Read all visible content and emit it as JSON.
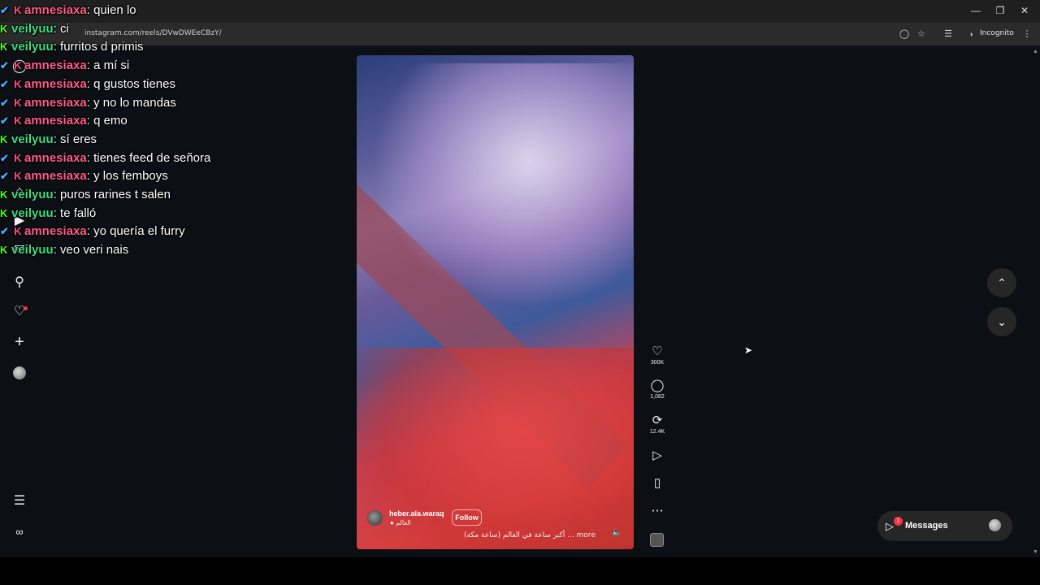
{
  "browser": {
    "url": "instagram.com/reels/DVwDWEeCBzY/",
    "incognito_label": "Incognito"
  },
  "reel": {
    "username": "heber.ala.waraq",
    "location": "العالم",
    "follow_label": "Follow",
    "caption": "أكبر ساعة في العالم (ساعة مكة) ... more",
    "likes": "300K",
    "comments": "1,082",
    "reposts": "12.4K"
  },
  "messages": {
    "label": "Messages",
    "badge": "1"
  },
  "chat": [
    {
      "user": "amnesiaxa",
      "text": ": quien lo",
      "color": "pink",
      "badges": [
        "v",
        "k2"
      ]
    },
    {
      "user": "veilyuu",
      "text": ": ci",
      "color": "green",
      "badges": [
        "k"
      ]
    },
    {
      "user": "veilyuu",
      "text": ": furritos d primis",
      "color": "green",
      "badges": [
        "k"
      ]
    },
    {
      "user": "amnesiaxa",
      "text": ": a mí si",
      "color": "pink",
      "badges": [
        "v",
        "k2"
      ]
    },
    {
      "user": "amnesiaxa",
      "text": ": q gustos tienes",
      "color": "pink",
      "badges": [
        "v",
        "k2"
      ]
    },
    {
      "user": "amnesiaxa",
      "text": ": y no lo mandas",
      "color": "pink",
      "badges": [
        "v",
        "k2"
      ]
    },
    {
      "user": "amnesiaxa",
      "text": ": q emo",
      "color": "pink",
      "badges": [
        "v",
        "k2"
      ]
    },
    {
      "user": "veilyuu",
      "text": ": sí eres",
      "color": "green",
      "badges": [
        "k"
      ]
    },
    {
      "user": "amnesiaxa",
      "text": ": tienes feed de señora",
      "color": "pink",
      "badges": [
        "v",
        "k2"
      ]
    },
    {
      "user": "amnesiaxa",
      "text": ": y los femboys",
      "color": "pink",
      "badges": [
        "v",
        "k2"
      ]
    },
    {
      "user": "veilyuu",
      "text": ": puros rarines t salen",
      "color": "green",
      "badges": [
        "k"
      ]
    },
    {
      "user": "veilyuu",
      "text": ": te falló",
      "color": "green",
      "badges": [
        "k"
      ]
    },
    {
      "user": "amnesiaxa",
      "text": ": yo quería el furry",
      "color": "pink",
      "badges": [
        "v",
        "k2"
      ]
    },
    {
      "user": "veilyuu",
      "text": ": veo veri nais",
      "color": "green",
      "badges": [
        "k"
      ]
    }
  ],
  "colors": {
    "background": "#0c1014",
    "chat_pink": "#ff5c8a",
    "chat_green": "#3ddc84",
    "badge_blue": "#4aa8ff",
    "badge_kick": "#53fc18",
    "notification_red": "#ff3040"
  },
  "icons": {
    "nav": [
      "home-icon",
      "reels-icon",
      "messenger-icon",
      "search-icon",
      "heart-icon",
      "create-icon",
      "profile-icon",
      "more-menu-icon",
      "meta-icon"
    ],
    "actions": [
      "heart-icon",
      "comment-icon",
      "repost-icon",
      "share-icon",
      "bookmark-icon",
      "more-icon"
    ]
  }
}
